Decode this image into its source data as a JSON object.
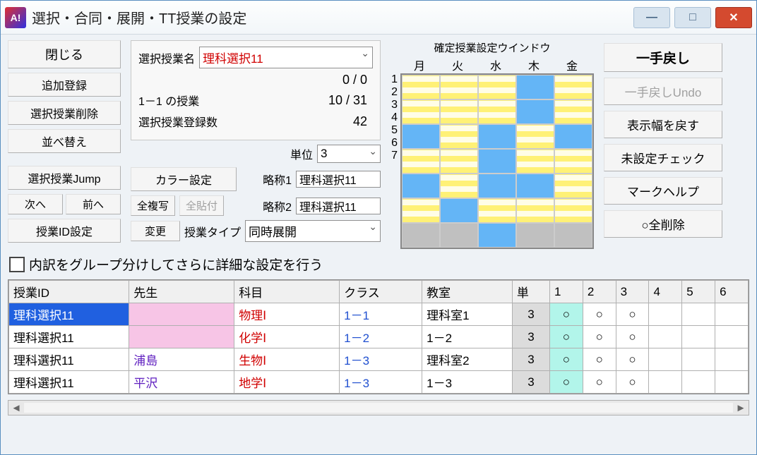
{
  "title": "選択・合同・展開・TT授業の設定",
  "win": {
    "min": "—",
    "max": "□",
    "close": "✕"
  },
  "left_buttons": {
    "close": "閉じる",
    "add": "追加登録",
    "delete": "選択授業削除",
    "sort": "並べ替え",
    "jump": "選択授業Jump",
    "next": "次へ",
    "prev": "前へ",
    "idset": "授業ID設定"
  },
  "center": {
    "name_label": "選択授業名",
    "name_value": "理科選択11",
    "count1": "0 / 0",
    "line2_label": "1－1 の授業",
    "line2_value": "10 / 31",
    "line3_label": "選択授業登録数",
    "line3_value": "42",
    "unit_label": "単位",
    "unit_value": "3",
    "abbr1_label": "略称1",
    "abbr1_value": "理科選択11",
    "abbr2_label": "略称2",
    "abbr2_value": "理科選択11",
    "type_label": "授業タイプ",
    "type_value": "同時展開",
    "color_btn": "カラー設定",
    "copy_btn": "全複写",
    "paste_btn": "全貼付",
    "change_btn": "変更"
  },
  "grid": {
    "title": "確定授業設定ウインドウ",
    "days": [
      "月",
      "火",
      "水",
      "木",
      "金"
    ],
    "rows": [
      "1",
      "2",
      "3",
      "4",
      "5",
      "6",
      "7"
    ],
    "cells": [
      [
        "y",
        "y",
        "y",
        "b",
        "y"
      ],
      [
        "y",
        "y",
        "y",
        "b",
        "y"
      ],
      [
        "b",
        "y",
        "b",
        "y",
        "b"
      ],
      [
        "y",
        "y",
        "b",
        "y",
        "y"
      ],
      [
        "b",
        "y",
        "b",
        "b",
        "y"
      ],
      [
        "y",
        "b",
        "y",
        "y",
        "y"
      ],
      [
        "g",
        "g",
        "b",
        "g",
        "g"
      ]
    ]
  },
  "right_buttons": {
    "undo": "一手戻し",
    "undo2": "一手戻しUndo",
    "reset_width": "表示幅を戻す",
    "check": "未設定チェック",
    "help": "マークヘルプ",
    "delete_all": "○全削除"
  },
  "checkbox_label": "内訳をグループ分けしてさらに詳細な設定を行う",
  "table": {
    "headers": [
      "授業ID",
      "先生",
      "科目",
      "クラス",
      "教室",
      "単",
      "1",
      "2",
      "3",
      "4",
      "5",
      "6"
    ],
    "rows": [
      {
        "id": "理科選択11",
        "sel": true,
        "teacher": "",
        "pink": true,
        "subject": "物理Ⅰ",
        "class": "1－1",
        "room": "理科室1",
        "unit": "3",
        "marks": [
          "○",
          "○",
          "○",
          "",
          "",
          ""
        ]
      },
      {
        "id": "理科選択11",
        "teacher": "",
        "pink": true,
        "subject": "化学Ⅰ",
        "class": "1－2",
        "room": "1－2",
        "unit": "3",
        "marks": [
          "○",
          "○",
          "○",
          "",
          "",
          ""
        ]
      },
      {
        "id": "理科選択11",
        "teacher": "浦島",
        "tcolor": "purple",
        "subject": "生物Ⅰ",
        "class": "1－3",
        "room": "理科室2",
        "unit": "3",
        "marks": [
          "○",
          "○",
          "○",
          "",
          "",
          ""
        ]
      },
      {
        "id": "理科選択11",
        "teacher": "平沢",
        "tcolor": "purple",
        "subject": "地学Ⅰ",
        "class": "1－3",
        "room": "1－3",
        "unit": "3",
        "marks": [
          "○",
          "○",
          "○",
          "",
          "",
          ""
        ]
      }
    ]
  }
}
